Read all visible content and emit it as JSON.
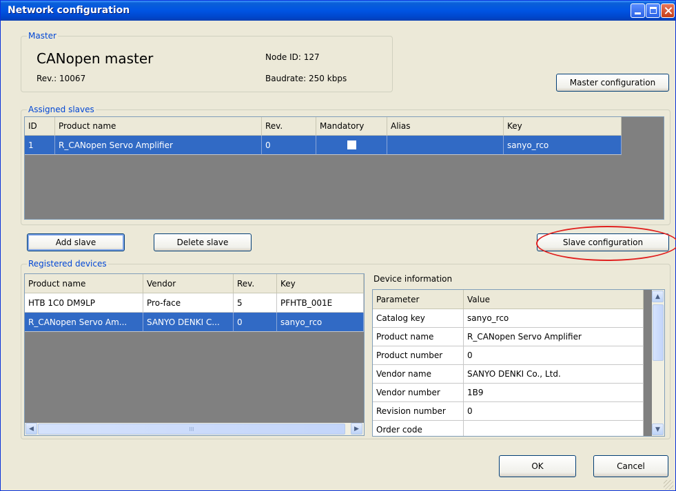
{
  "window": {
    "title": "Network configuration"
  },
  "master": {
    "group_label": "Master",
    "name": "CANopen master",
    "rev": "Rev.: 10067",
    "node_id": "Node ID: 127",
    "baudrate": "Baudrate: 250 kbps",
    "config_button": "Master configuration"
  },
  "assigned_slaves": {
    "group_label": "Assigned slaves",
    "columns": [
      "ID",
      "Product name",
      "Rev.",
      "Mandatory",
      "Alias",
      "Key"
    ],
    "rows": [
      {
        "id": "1",
        "product": "R_CANopen Servo Amplifier",
        "rev": "0",
        "mandatory": false,
        "alias": "",
        "key": "sanyo_rco"
      }
    ]
  },
  "buttons": {
    "add_slave": "Add slave",
    "delete_slave": "Delete slave",
    "slave_configuration": "Slave configuration",
    "ok": "OK",
    "cancel": "Cancel"
  },
  "registered_devices": {
    "group_label": "Registered devices",
    "columns": [
      "Product name",
      "Vendor",
      "Rev.",
      "Key"
    ],
    "rows": [
      {
        "product": "HTB 1C0 DM9LP",
        "vendor": "Pro-face",
        "rev": "5",
        "key": "PFHTB_001E"
      },
      {
        "product": "R_CANopen Servo Am...",
        "vendor": "SANYO DENKI C...",
        "rev": "0",
        "key": "sanyo_rco"
      }
    ],
    "scroll_grip": "III"
  },
  "device_info": {
    "label": "Device information",
    "columns": [
      "Parameter",
      "Value"
    ],
    "rows": [
      {
        "param": "Catalog key",
        "value": "sanyo_rco"
      },
      {
        "param": "Product name",
        "value": "R_CANopen Servo Amplifier"
      },
      {
        "param": "Product number",
        "value": "0"
      },
      {
        "param": "Vendor name",
        "value": "SANYO DENKI Co., Ltd."
      },
      {
        "param": "Vendor number",
        "value": "1B9"
      },
      {
        "param": "Revision number",
        "value": "0"
      },
      {
        "param": "Order code",
        "value": ""
      }
    ]
  },
  "colors": {
    "titlebar": "#0054e3",
    "selection": "#316ac5",
    "group_label": "#0046d5",
    "highlight": "#e0201e",
    "grid_background": "#808080"
  }
}
